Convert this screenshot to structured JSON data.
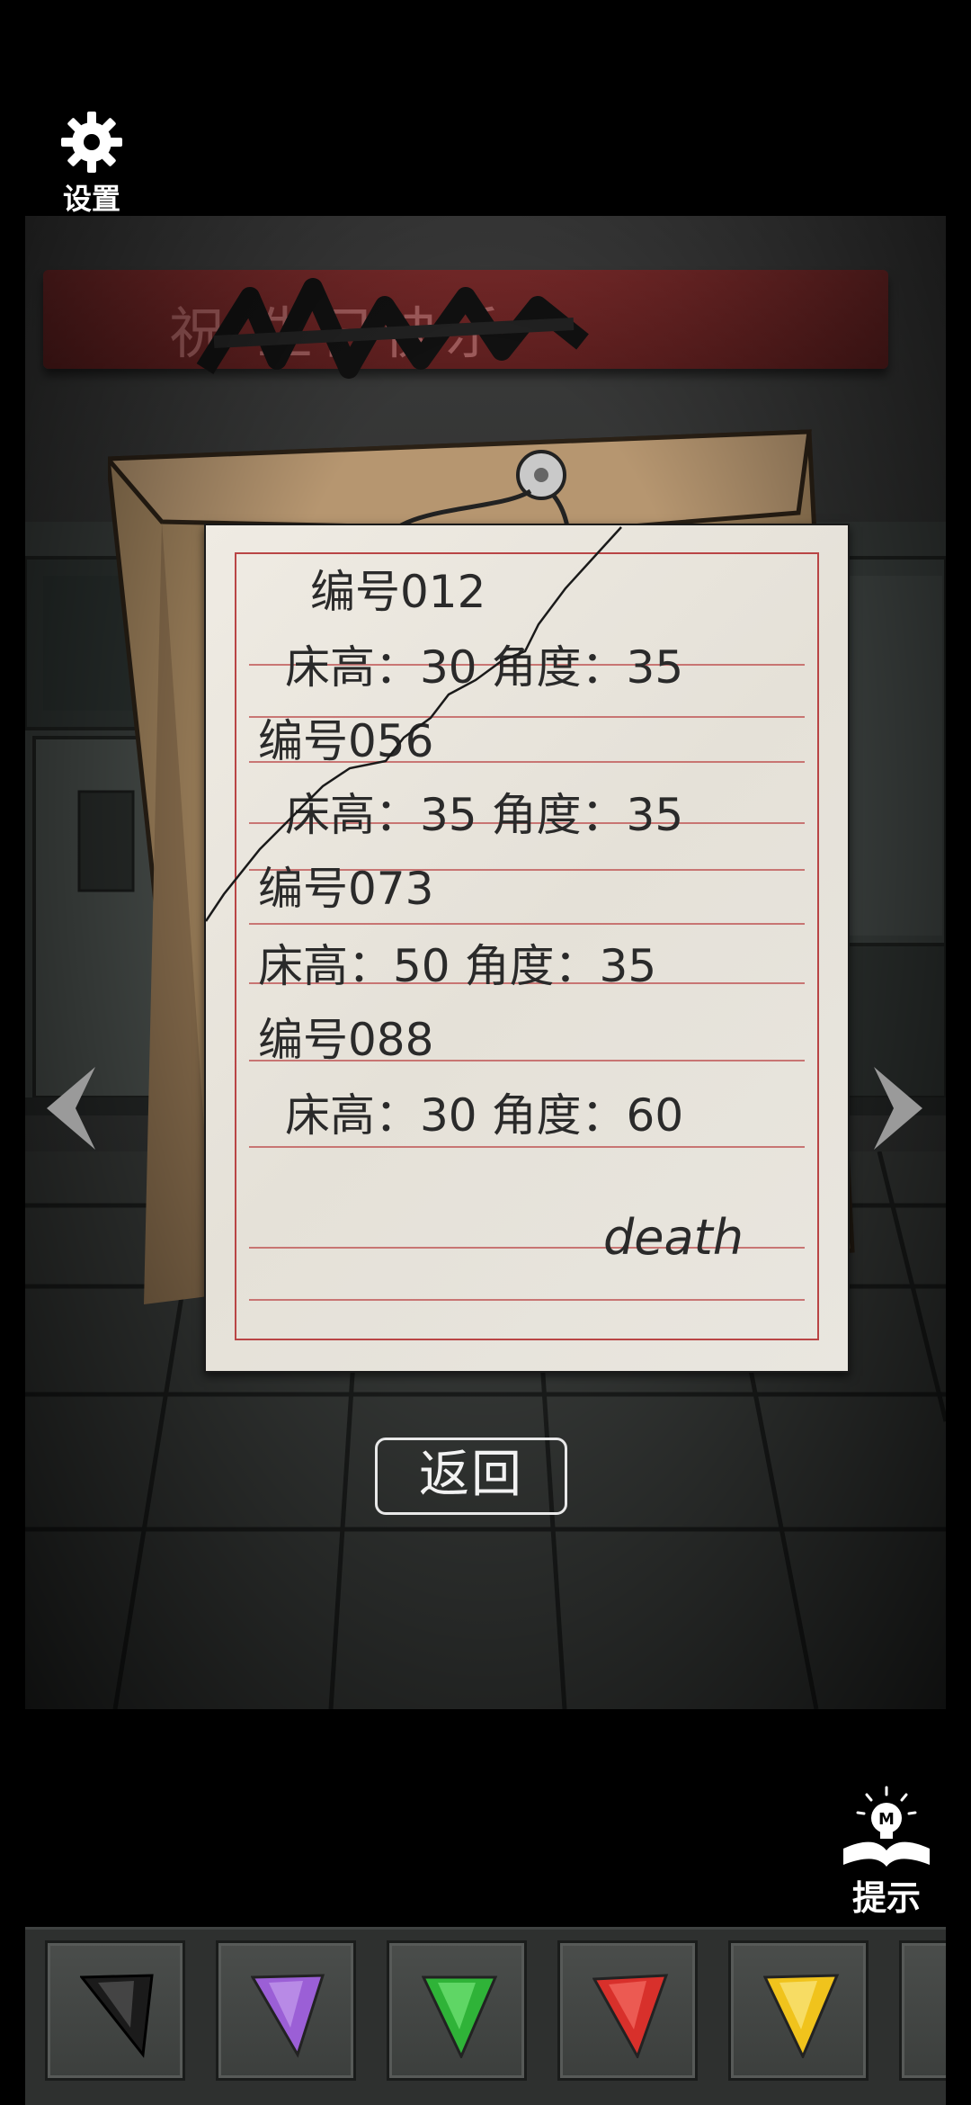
{
  "settings": {
    "label": "设置",
    "icon": "gear-icon"
  },
  "banner": {
    "text": "祝 生日快乐"
  },
  "note": {
    "lines": [
      "编号012",
      "床高：30 角度：35",
      "编号056",
      "床高：35 角度：35",
      "编号073",
      "床高：50 角度：35",
      "编号088",
      "床高：30 角度：60"
    ],
    "signature": "death"
  },
  "navigation": {
    "left_icon": "chevron-left-icon",
    "right_icon": "chevron-right-icon"
  },
  "back_button": {
    "label": "返回"
  },
  "hint": {
    "label": "提示",
    "icon": "lightbulb-book-icon"
  },
  "inventory": {
    "items": [
      {
        "name": "black-flag",
        "color": "#1b1b1b"
      },
      {
        "name": "purple-flag",
        "color": "#9b5fd6"
      },
      {
        "name": "green-flag",
        "color": "#2fb338"
      },
      {
        "name": "red-flag",
        "color": "#d8302b"
      },
      {
        "name": "yellow-flag",
        "color": "#f0c31c"
      }
    ]
  }
}
